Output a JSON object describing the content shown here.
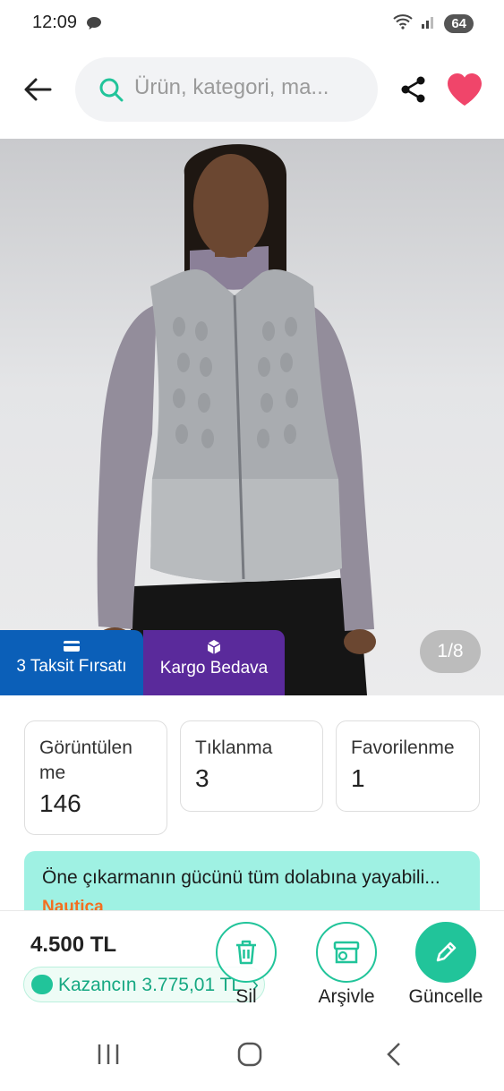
{
  "status_bar": {
    "time": "12:09",
    "battery": "64",
    "icons": [
      "message-icon",
      "wifi-icon",
      "signal-icon",
      "battery-icon"
    ]
  },
  "top_bar": {
    "search_placeholder": "Ürün, kategori, ma...",
    "icons": [
      "back-arrow-icon",
      "search-icon",
      "share-icon",
      "heart-icon"
    ],
    "accent_color": "#21c49a",
    "favorite_color": "#f0456a"
  },
  "product_image": {
    "counter": "1/8",
    "badges": [
      {
        "label": "3 Taksit Fırsatı",
        "icon": "credit-card-icon",
        "color": "#0b5fb8"
      },
      {
        "label": "Kargo Bedava",
        "icon": "box-icon",
        "color": "#5a2a9b"
      }
    ]
  },
  "stats": [
    {
      "label": "Görüntülenme",
      "label_display": "Görüntülen\nme",
      "value": "146"
    },
    {
      "label": "Tıklanma",
      "value": "3"
    },
    {
      "label": "Favorilenme",
      "value": "1"
    }
  ],
  "promo": {
    "text": "Öne çıkarmanın gücünü tüm dolabına yayabili...",
    "brand": "Nautica",
    "color": "#9ff1e3"
  },
  "bottom": {
    "price": "4.500 TL",
    "earnings": "Kazancın 3.775,01 TL",
    "actions": [
      {
        "label": "Sil",
        "icon": "trash-icon"
      },
      {
        "label": "Arşivle",
        "icon": "archive-icon"
      },
      {
        "label": "Güncelle",
        "icon": "pencil-icon"
      }
    ]
  },
  "nav": {
    "icons": [
      "recents-icon",
      "home-icon",
      "back-icon"
    ]
  }
}
